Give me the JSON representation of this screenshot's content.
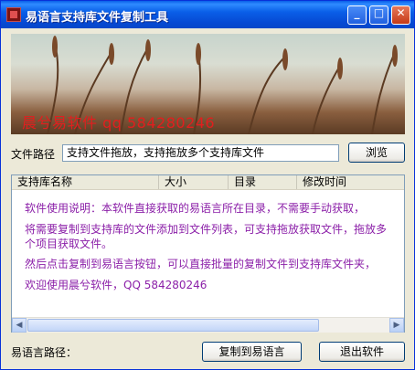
{
  "window": {
    "title": "易语言支持库文件复制工具",
    "minimize_symbol": "_",
    "maximize_symbol": "□",
    "close_symbol": "✕"
  },
  "banner": {
    "text": "晨兮易软件  qq  584280246"
  },
  "file_path": {
    "label": "文件路径",
    "value": "支持文件拖放，支持拖放多个支持库文件",
    "browse_label": "浏览"
  },
  "list": {
    "columns": [
      "支持库名称",
      "大小",
      "目录",
      "修改时间"
    ],
    "info_lines": [
      "软件使用说明：本软件直接获取的易语言所在目录，不需要手动获取，",
      "将需要复制到支持库的文件添加到文件列表，可支持拖放获取文件，拖放多",
      "个项目获取文件。",
      "然后点击复制到易语言按钮，可以直接批量的复制文件到支持库文件夹，",
      "欢迎使用晨兮软件，QQ  584280246"
    ],
    "scroll_left": "◀",
    "scroll_right": "▶"
  },
  "footer": {
    "path_label": "易语言路径：",
    "copy_label": "复制到易语言",
    "exit_label": "退出软件"
  }
}
